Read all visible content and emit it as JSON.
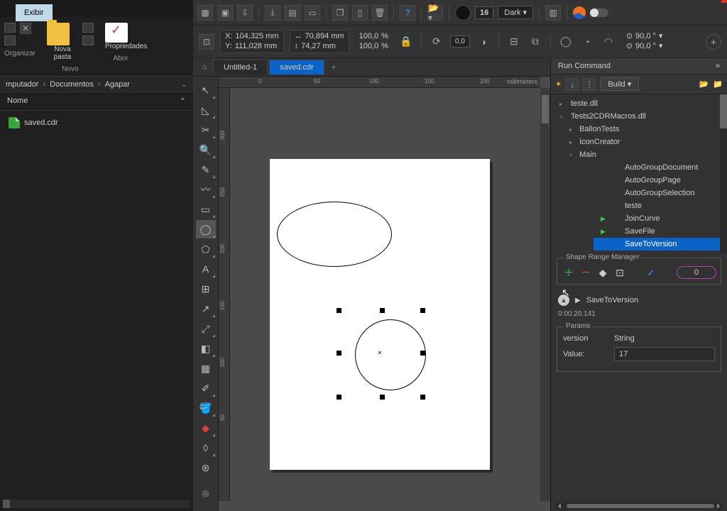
{
  "explorer": {
    "menu": "Exibir",
    "groups": {
      "organizar": "Organizar",
      "novo": "Novo",
      "abrir": "Abrir"
    },
    "nova_pasta": "Nova\npasta",
    "propriedades": "Propriedades",
    "breadcrumb": [
      "mputador",
      "Documentos",
      "Agapar"
    ],
    "col_nome": "Nome",
    "files": [
      "saved.cdr"
    ]
  },
  "topbar": {
    "num": "16",
    "theme": "Dark"
  },
  "propbar": {
    "x_label": "X:",
    "x": "104,325 mm",
    "y_label": "Y:",
    "y": "111,028 mm",
    "w": "70,894 mm",
    "h": "74,27 mm",
    "sx": "100,0",
    "sy": "100,0",
    "pct": "%",
    "rot": "0,0",
    "a1": "90,0 °",
    "a2": "90,0 °"
  },
  "tabs": {
    "t1": "Untitled-1",
    "t2": "saved.cdr"
  },
  "ruler": {
    "h": [
      "0",
      "50",
      "100",
      "150",
      "200"
    ],
    "unit": "millimeters",
    "v": [
      "300",
      "250",
      "200",
      "150",
      "100",
      "50"
    ]
  },
  "docker": {
    "title": "Run Command",
    "build": "Build",
    "tree": {
      "n0": "teste.dll",
      "n1": "Tests2CDRMacros.dll",
      "n2": "BallonTests",
      "n3": "IconCreator",
      "n4": "Main",
      "m0": "AutoGroupDocument",
      "m1": "AutoGroupPage",
      "m2": "AutoGroupSelection",
      "m3": "teste",
      "m4": "JoinCurve",
      "m5": "SaveFile",
      "m6": "SaveToVersion"
    },
    "shape_title": "Shape Range Manager",
    "shape_count": "0",
    "run_name": "SaveToVersion",
    "elapsed": "0:00:20.141",
    "params_title": "Params",
    "p_version": "version",
    "p_string": "String",
    "p_value_label": "Value:",
    "p_value": "17"
  }
}
